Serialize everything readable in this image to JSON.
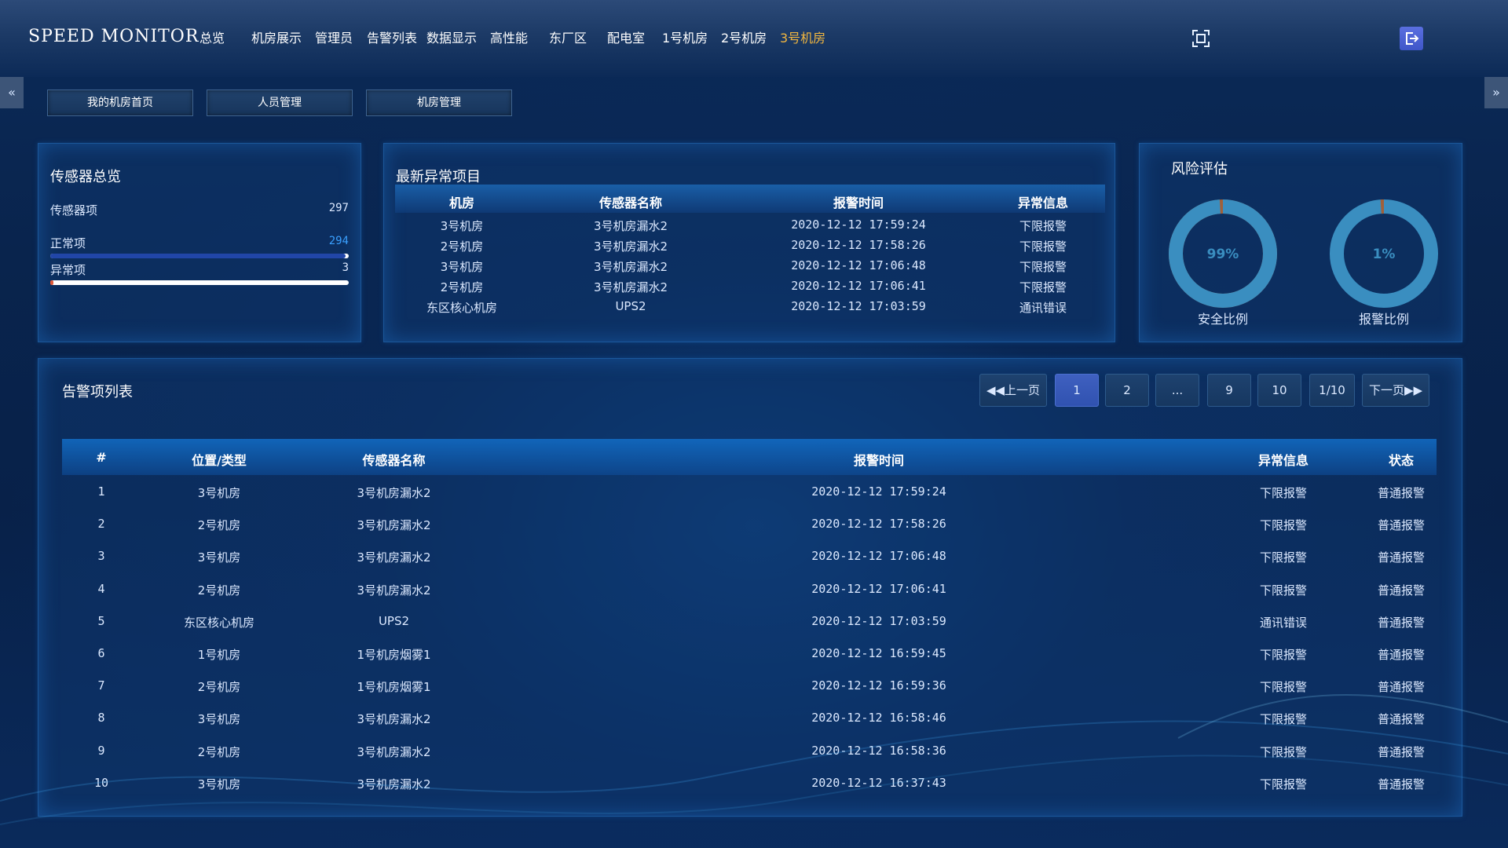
{
  "header": {
    "brand": "SPEED MONITOR",
    "nav": [
      {
        "label": "总览",
        "active": true
      },
      {
        "label": "机房展示"
      },
      {
        "label": "管理员"
      },
      {
        "label": "告警列表"
      },
      {
        "label": "数据显示"
      },
      {
        "label": "高性能"
      },
      {
        "label": "东厂区"
      },
      {
        "label": "配电室"
      },
      {
        "label": "1号机房"
      },
      {
        "label": "2号机房"
      },
      {
        "label": "3号机房",
        "highlight": true
      }
    ],
    "icons": {
      "fullscreen": "fullscreen-icon",
      "logout": "logout-icon"
    }
  },
  "side_arrows": {
    "left": "«",
    "right": "»"
  },
  "sub_nav": [
    "我的机房首页",
    "人员管理",
    "机房管理"
  ],
  "sensor_overview": {
    "title": "传感器总览",
    "total_label": "传感器项",
    "total_value": "297",
    "normal_label": "正常项",
    "normal_value": "294",
    "normal_fraction": 0.99,
    "abnormal_label": "异常项",
    "abnormal_value": "3",
    "abnormal_fraction": 0.01,
    "colors": {
      "normal_bar": "#2146a8",
      "abnormal_bar": "#e05a3a",
      "normal_value": "#3aa0ff"
    }
  },
  "abnormal": {
    "title": "最新异常项目",
    "columns": [
      "机房",
      "传感器名称",
      "报警时间",
      "异常信息"
    ],
    "rows": [
      [
        "3号机房",
        "3号机房漏水2",
        "2020-12-12 17:59:24",
        "下限报警"
      ],
      [
        "2号机房",
        "3号机房漏水2",
        "2020-12-12 17:58:26",
        "下限报警"
      ],
      [
        "3号机房",
        "3号机房漏水2",
        "2020-12-12 17:06:48",
        "下限报警"
      ],
      [
        "2号机房",
        "3号机房漏水2",
        "2020-12-12 17:06:41",
        "下限报警"
      ],
      [
        "东区核心机房",
        "UPS2",
        "2020-12-12 17:03:59",
        "通讯错误"
      ]
    ]
  },
  "risk": {
    "title": "风险评估",
    "safe": {
      "value_text": "99%",
      "fraction": 0.99,
      "label": "安全比例",
      "color": "#3a8ec0"
    },
    "alarm": {
      "value_text": "1%",
      "fraction": 0.01,
      "label": "报警比例",
      "color": "#a0603a"
    }
  },
  "alarm_list": {
    "title": "告警项列表",
    "pager": {
      "prev": "上一页",
      "next": "下一页",
      "pages": [
        "1",
        "2",
        "...",
        "9",
        "10"
      ],
      "current": "1",
      "info": "1/10"
    },
    "columns": [
      "#",
      "位置/类型",
      "传感器名称",
      "报警时间",
      "异常信息",
      "状态"
    ],
    "rows": [
      [
        "1",
        "3号机房",
        "3号机房漏水2",
        "2020-12-12 17:59:24",
        "下限报警",
        "普通报警"
      ],
      [
        "2",
        "2号机房",
        "3号机房漏水2",
        "2020-12-12 17:58:26",
        "下限报警",
        "普通报警"
      ],
      [
        "3",
        "3号机房",
        "3号机房漏水2",
        "2020-12-12 17:06:48",
        "下限报警",
        "普通报警"
      ],
      [
        "4",
        "2号机房",
        "3号机房漏水2",
        "2020-12-12 17:06:41",
        "下限报警",
        "普通报警"
      ],
      [
        "5",
        "东区核心机房",
        "UPS2",
        "2020-12-12 17:03:59",
        "通讯错误",
        "普通报警"
      ],
      [
        "6",
        "1号机房",
        "1号机房烟雾1",
        "2020-12-12 16:59:45",
        "下限报警",
        "普通报警"
      ],
      [
        "7",
        "2号机房",
        "1号机房烟雾1",
        "2020-12-12 16:59:36",
        "下限报警",
        "普通报警"
      ],
      [
        "8",
        "3号机房",
        "3号机房漏水2",
        "2020-12-12 16:58:46",
        "下限报警",
        "普通报警"
      ],
      [
        "9",
        "2号机房",
        "3号机房漏水2",
        "2020-12-12 16:58:36",
        "下限报警",
        "普通报警"
      ],
      [
        "10",
        "3号机房",
        "3号机房漏水2",
        "2020-12-12 16:37:43",
        "下限报警",
        "普通报警"
      ]
    ]
  }
}
